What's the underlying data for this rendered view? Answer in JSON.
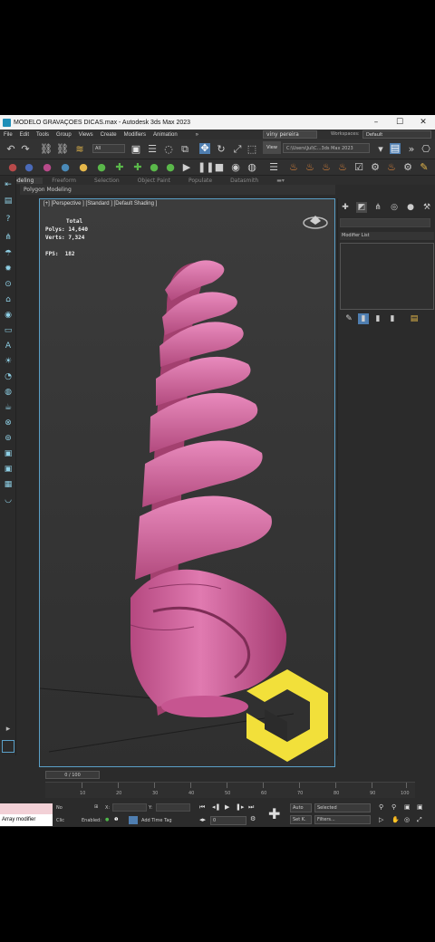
{
  "window": {
    "title": "MODELO GRAVAÇOES DICAS.max - Autodesk 3ds Max 2023",
    "minimize": "–",
    "maximize": "☐",
    "close": "✕"
  },
  "menu": {
    "items": [
      "File",
      "Edit",
      "Tools",
      "Group",
      "Views",
      "Create",
      "Modifiers",
      "Animation"
    ],
    "more": "»",
    "user": "viny pereira",
    "workspaces_label": "Workspaces:",
    "workspace": "Default"
  },
  "toolbar": {
    "selection_filter": "All",
    "view_button": "View",
    "project_path": "C:\\Users\\Jul\\C...3ds Max 2023"
  },
  "ribbon": {
    "tabs": [
      "Modeling",
      "Freeform",
      "Selection",
      "Object Paint",
      "Populate",
      "Datasmith"
    ],
    "active_tab": "Modeling",
    "subtitle": "Polygon Modeling"
  },
  "viewport": {
    "label": "[+] [Perspective ] [Standard ] [Default Shading ]",
    "stats_title": "Total",
    "polys_label": "Polys:",
    "polys_value": "14,640",
    "verts_label": "Verts:",
    "verts_value": "7,324",
    "fps_label": "FPS:",
    "fps_value": "182",
    "object_color": "#d9669e"
  },
  "command_panel": {
    "modifier_list_label": "Modifier List"
  },
  "timeline": {
    "frame_display": "0 / 100",
    "ticks": [
      "10",
      "20",
      "30",
      "40",
      "50",
      "60",
      "70",
      "80",
      "90",
      "100"
    ]
  },
  "status": {
    "prompt": "Array modifier",
    "selection_label": "No",
    "click_label": "Clic",
    "x_label": "X:",
    "y_label": "Y:",
    "enabled_label": "Enabled:",
    "add_time_tag": "Add Time Tag",
    "auto_label": "Auto",
    "set_key_label": "Set K.",
    "selected_label": "Selected",
    "filters_label": "Filters...",
    "frame_value": "0"
  },
  "colors": {
    "accent_blue": "#5aa0c8",
    "logo_yellow": "#f2e03a"
  }
}
